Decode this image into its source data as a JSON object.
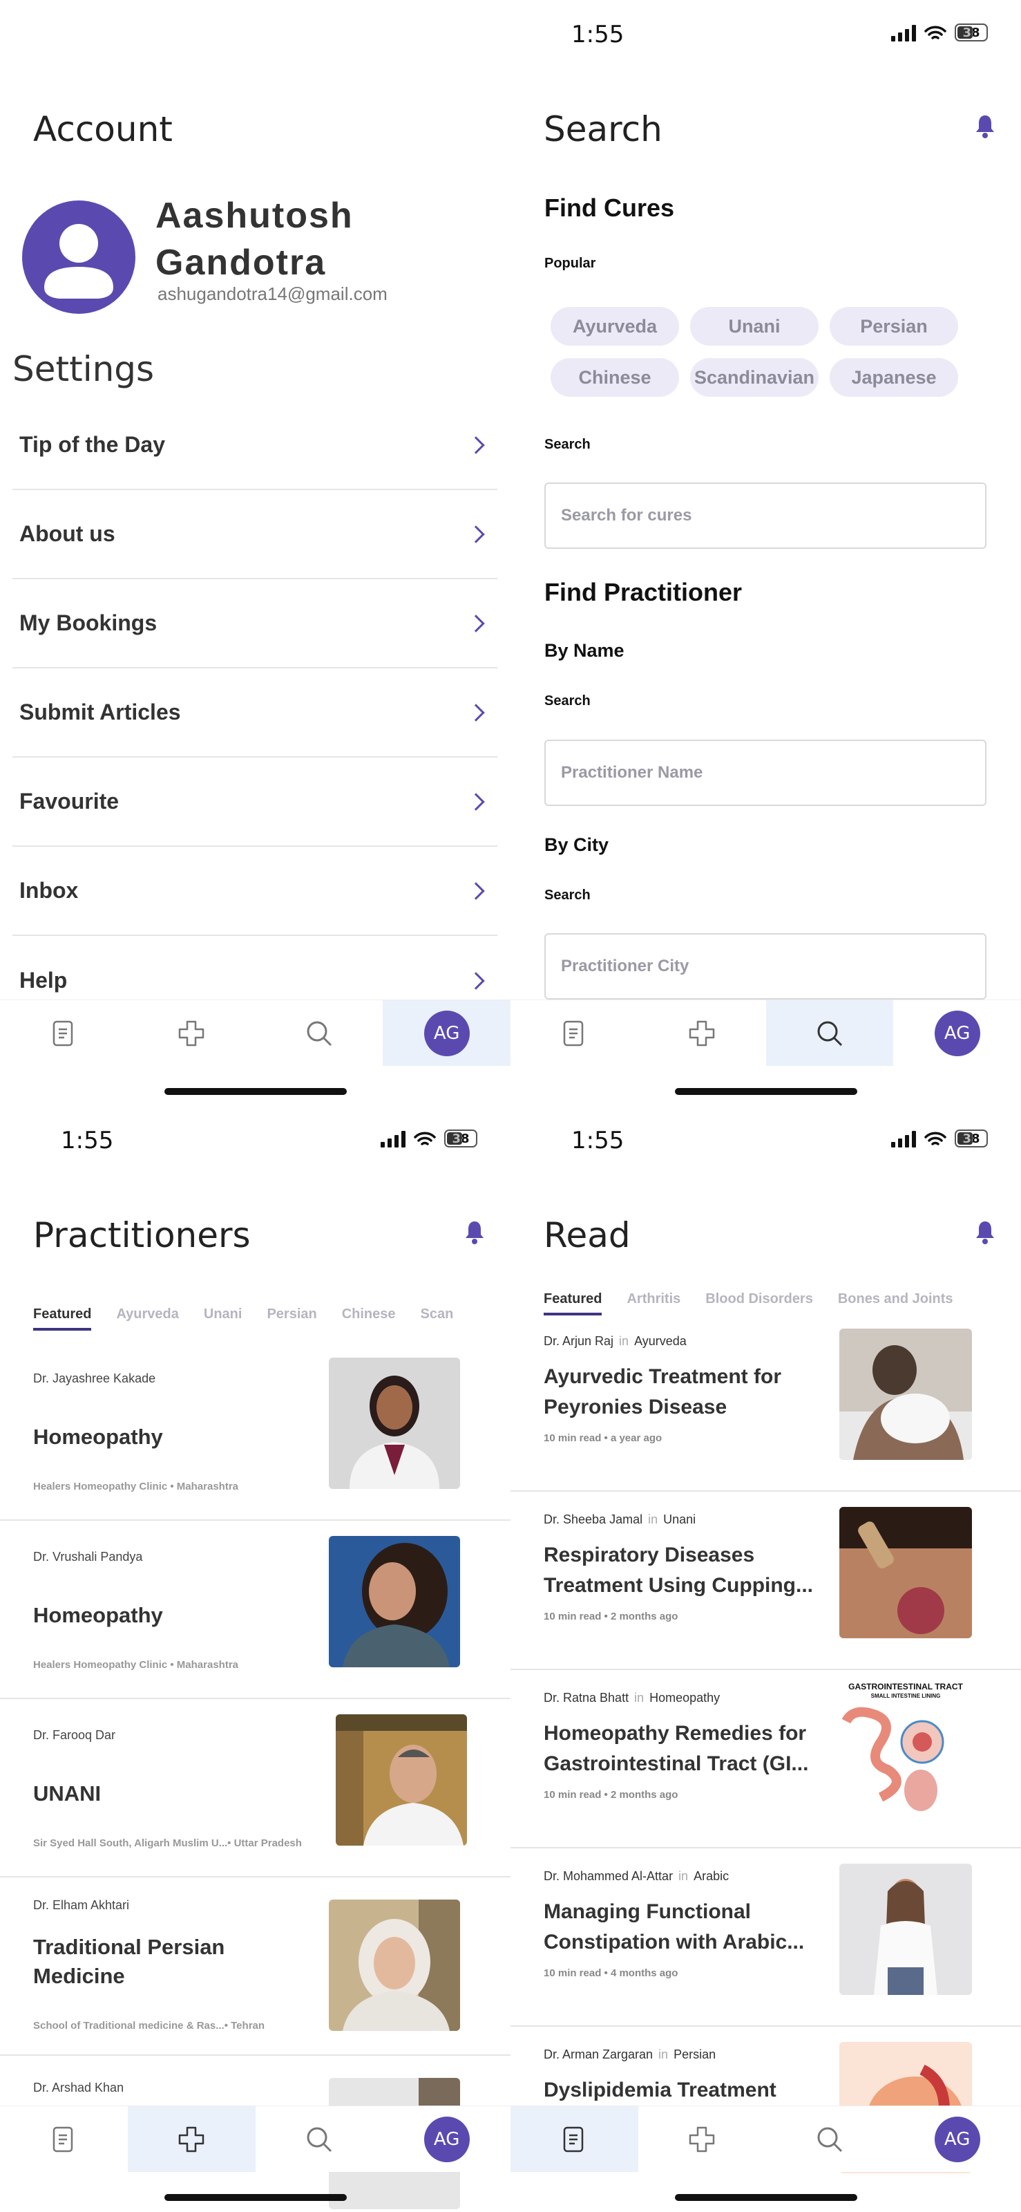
{
  "status": {
    "time": "1:55",
    "battery": "38"
  },
  "nav": {
    "avatar_initials": "AG"
  },
  "account": {
    "title": "Account",
    "name": "Aashutosh Gandotra",
    "email": "ashugandotra14@gmail.com",
    "settings_title": "Settings",
    "items": [
      "Tip of the Day",
      "About us",
      "My Bookings",
      "Submit Articles",
      "Favourite",
      "Inbox",
      "Help"
    ]
  },
  "search": {
    "title": "Search",
    "find_cures": "Find Cures",
    "popular_label": "Popular",
    "chips": [
      "Ayurveda",
      "Unani",
      "Persian",
      "Chinese",
      "Scandinavian",
      "Japanese"
    ],
    "search_label": "Search",
    "cure_placeholder": "Search for cures",
    "find_practitioner": "Find Practitioner",
    "by_name": "By Name",
    "name_placeholder": "Practitioner Name",
    "by_city": "By City",
    "city_placeholder": "Practitioner City"
  },
  "practitioners": {
    "title": "Practitioners",
    "tabs": [
      "Featured",
      "Ayurveda",
      "Unani",
      "Persian",
      "Chinese",
      "Scan"
    ],
    "cards": [
      {
        "doctor": "Dr. Jayashree Kakade",
        "specialty": "Homeopathy",
        "location": "Healers Homeopathy Clinic • Maharashtra"
      },
      {
        "doctor": "Dr. Vrushali Pandya",
        "specialty": "Homeopathy",
        "location": "Healers Homeopathy Clinic • Maharashtra"
      },
      {
        "doctor": "Dr. Farooq Dar",
        "specialty": "UNANI",
        "location": "Sir Syed Hall South, Aligarh Muslim U...• Uttar Pradesh"
      },
      {
        "doctor": "Dr. Elham Akhtari",
        "specialty": "Traditional Persian Medicine",
        "location": "School of Traditional medicine & Ras...• Tehran"
      },
      {
        "doctor": "Dr. Arshad Khan",
        "specialty": "",
        "location": ""
      }
    ]
  },
  "read": {
    "title": "Read",
    "tabs": [
      "Featured",
      "Arthritis",
      "Blood Disorders",
      "Bones and Joints"
    ],
    "in_word": "in",
    "articles": [
      {
        "author": "Dr. Arjun Raj",
        "category": "Ayurveda",
        "title": "Ayurvedic Treatment for Peyronies Disease",
        "meta": "10 min read • a year ago"
      },
      {
        "author": "Dr. Sheeba Jamal",
        "category": "Unani",
        "title": "Respiratory Diseases Treatment Using Cupping...",
        "meta": "10 min read • 2 months ago"
      },
      {
        "author": "Dr. Ratna Bhatt",
        "category": "Homeopathy",
        "title": "Homeopathy Remedies for Gastrointestinal Tract (GI...",
        "meta": "10 min read • 2 months ago"
      },
      {
        "author": "Dr. Mohammed Al-Attar",
        "category": "Arabic",
        "title": "Managing Functional Constipation with Arabic...",
        "meta": "10 min read • 4 months ago"
      },
      {
        "author": "Dr. Arman Zargaran",
        "category": "Persian",
        "title": "Dyslipidemia Treatment",
        "meta": ""
      }
    ],
    "image_text": {
      "gi_title": "GASTROINTESTINAL TRACT",
      "gi_subtitle": "SMALL INTESTINE LINING"
    }
  },
  "colors": {
    "accent": "#5a4ab0",
    "active_nav": "#eaf1fb",
    "chip_bg": "#eceaf6"
  }
}
